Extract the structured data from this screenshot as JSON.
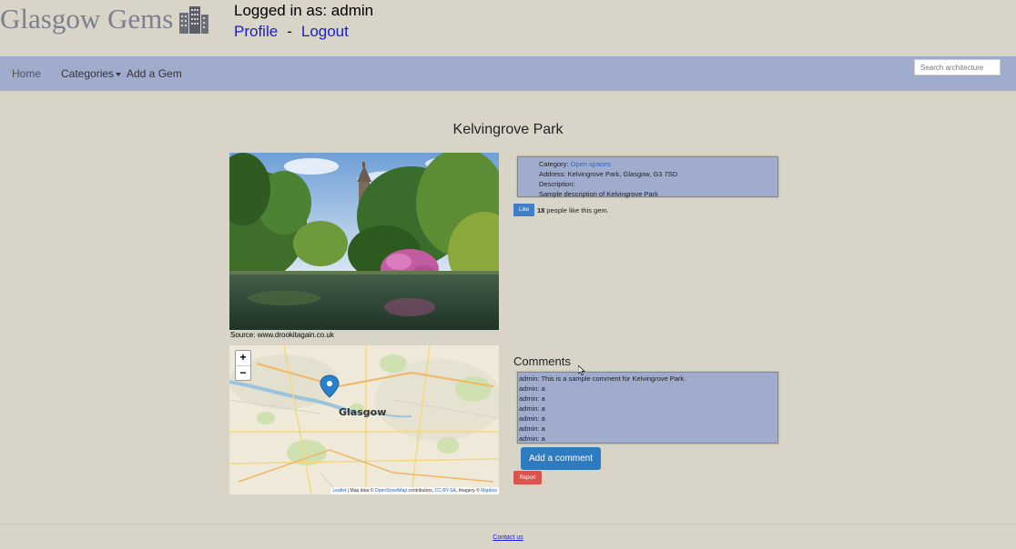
{
  "header": {
    "logo_text": "Glasgow Gems",
    "logo_icon": "buildings-icon",
    "logged_in_text": "Logged in as: admin",
    "profile_link": "Profile",
    "separator": "-",
    "logout_link": "Logout"
  },
  "nav": {
    "home": "Home",
    "categories": "Categories",
    "add_gem": "Add a Gem",
    "search_placeholder": "Search architecture"
  },
  "gem": {
    "title": "Kelvingrove Park",
    "image_source": "Source: www.drookitagain.co.uk",
    "category_label": "Category:",
    "category_value": "Open spaces",
    "address": "Address: Kelvingrove Park, Glasgow, G3 7SD",
    "description_label": "Description:",
    "description": "Sample description of Kelvingrove Park",
    "like_button": "Like",
    "like_count": "18",
    "like_text": "people like this gem."
  },
  "map": {
    "zoom_in": "+",
    "zoom_out": "−",
    "place_label": "Glasgow",
    "leaflet": "Leaflet",
    "attr_1": " | Map data © ",
    "osm": "OpenStreetMap",
    "attr_2": " contributors, ",
    "ccbysa": "CC-BY-SA",
    "attr_3": ", Imagery © ",
    "mapbox": "Mapbox"
  },
  "comments": {
    "heading": "Comments",
    "items": [
      "admin: This is a sample comment for Kelvingrove Park.",
      "admin: a",
      "admin: a",
      "admin: a",
      "admin: a",
      "admin: a",
      "admin: a"
    ],
    "add_button": "Add a comment",
    "report_button": "Report"
  },
  "footer": {
    "contact": "Contact us"
  },
  "colors": {
    "background": "#d8d5c8",
    "navbar": "#9faccd",
    "primary_button": "#2f7bbf",
    "danger_button": "#d9534f",
    "link": "#1a1ad6"
  }
}
